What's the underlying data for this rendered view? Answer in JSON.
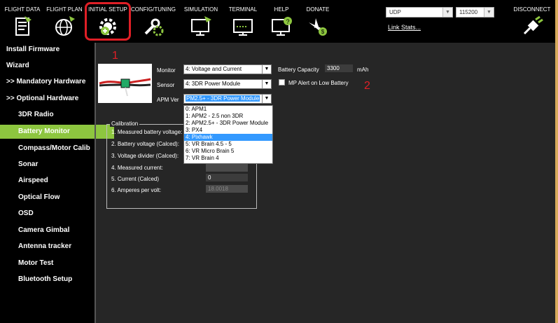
{
  "toolbar": {
    "items": [
      {
        "label": "FLIGHT DATA",
        "icon": "flight-data-icon"
      },
      {
        "label": "FLIGHT PLAN",
        "icon": "globe-icon"
      },
      {
        "label": "INITIAL SETUP",
        "icon": "initial-setup-gear-icon"
      },
      {
        "label": "CONFIG/TUNING",
        "icon": "wrench-gear-icon"
      },
      {
        "label": "SIMULATION",
        "icon": "simulation-monitor-icon"
      },
      {
        "label": "TERMINAL",
        "icon": "terminal-icon"
      },
      {
        "label": "HELP",
        "icon": "help-monitor-icon"
      },
      {
        "label": "DONATE",
        "icon": "donate-plane-icon"
      }
    ],
    "port": "UDP",
    "baud": "115200",
    "link_stats": "Link Stats...",
    "connect": "DISCONNECT"
  },
  "sidebar": {
    "items": [
      {
        "label": "Install Firmware"
      },
      {
        "label": "Wizard"
      },
      {
        "label": ">> Mandatory Hardware"
      },
      {
        "label": ">> Optional Hardware"
      },
      {
        "label": "3DR Radio"
      },
      {
        "label": "Battery Monitor"
      },
      {
        "label": "Compass/Motor Calib"
      },
      {
        "label": "Sonar"
      },
      {
        "label": "Airspeed"
      },
      {
        "label": "Optical Flow"
      },
      {
        "label": "OSD"
      },
      {
        "label": "Camera Gimbal"
      },
      {
        "label": "Antenna tracker"
      },
      {
        "label": "Motor Test"
      },
      {
        "label": "Bluetooth Setup"
      }
    ]
  },
  "annotations": {
    "one": "1",
    "two": "2"
  },
  "battery": {
    "monitor_label": "Monitor",
    "monitor_value": "4: Voltage and Current",
    "sensor_label": "Sensor",
    "sensor_value": "4: 3DR Power Module",
    "apm_label": "APM Ver",
    "apm_value": "PM2.5+ - 3DR Power Module",
    "capacity_label": "Battery Capacity",
    "capacity_value": "3300",
    "capacity_unit": "mAh",
    "alert_label": "MP Alert on Low Battery"
  },
  "dropdown": {
    "options": [
      "0: APM1",
      "1: APM2 - 2.5 non 3DR",
      "2: APM2.5+ - 3DR Power Module",
      "3: PX4",
      "4: Pixhawk",
      "5: VR Brain 4.5 - 5",
      "6: VR Micro Brain 5",
      "7: VR Brain 4"
    ]
  },
  "calibration": {
    "title": "Calibration",
    "rows": [
      {
        "label": "1. Measured battery voltage:",
        "value": ""
      },
      {
        "label": "2. Battery voltage (Calced):",
        "value": ""
      },
      {
        "label": "3. Voltage divider (Calced):",
        "value": ""
      },
      {
        "label": "4. Measured current:",
        "value": ""
      },
      {
        "label": "5. Current (Calced)",
        "value": "0"
      },
      {
        "label": "6. Amperes per volt:",
        "value": "18.0018"
      }
    ]
  },
  "colors": {
    "accent": "#8dc63f",
    "annotation": "#e01f26",
    "highlight": "#3399ff"
  }
}
